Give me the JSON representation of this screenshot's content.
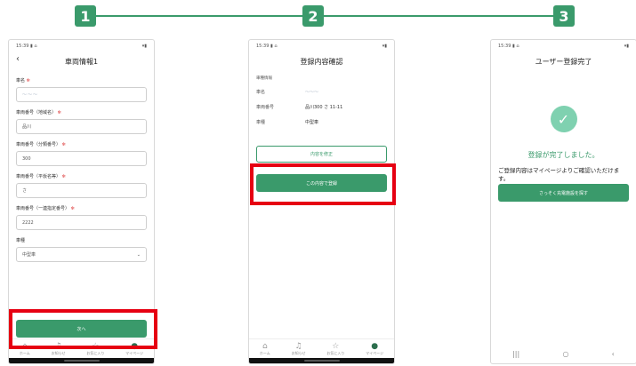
{
  "steps": [
    "1",
    "2",
    "3"
  ],
  "status": {
    "time": "15:39 ▮ ⌂",
    "signal": "▾▮"
  },
  "screen1": {
    "title": "車両情報1",
    "fields": [
      {
        "label": "車名",
        "value": "",
        "placeholder_blur": "〜〜〜"
      },
      {
        "label": "車両番号（地域名）",
        "value": "品川"
      },
      {
        "label": "車両番号（分類番号）",
        "value": "300"
      },
      {
        "label": "車両番号（平仮名等）",
        "value": "さ"
      },
      {
        "label": "車両番号（一連指定番号）",
        "value": "2222"
      }
    ],
    "type_label": "車種",
    "type_value": "中型車",
    "next_button": "次へ"
  },
  "screen2": {
    "title": "登録内容確認",
    "section": "車種情報",
    "rows": [
      {
        "k": "車名",
        "v": "〜〜〜"
      },
      {
        "k": "車両番号",
        "v": "品川300 さ 11-11"
      },
      {
        "k": "車種",
        "v": "中型車"
      }
    ],
    "edit_button": "内容を修正",
    "submit_button": "この内容で登録"
  },
  "screen3": {
    "title": "ユーザー登録完了",
    "check": "✓",
    "done_title": "登録が完了しました。",
    "done_text": "ご登録内容はマイページよりご確認いただけます。",
    "search_button": "さっそく充電施設を探す",
    "nav": [
      "|||",
      "○",
      "‹"
    ]
  },
  "tabs": [
    {
      "label": "ホーム",
      "icon": "⌂"
    },
    {
      "label": "お知らせ",
      "icon": "🔔"
    },
    {
      "label": "お気に入り",
      "icon": "☆"
    },
    {
      "label": "マイページ",
      "icon": "👤"
    }
  ],
  "colors": {
    "accent": "#3a9a6b",
    "highlight": "#e60012"
  }
}
